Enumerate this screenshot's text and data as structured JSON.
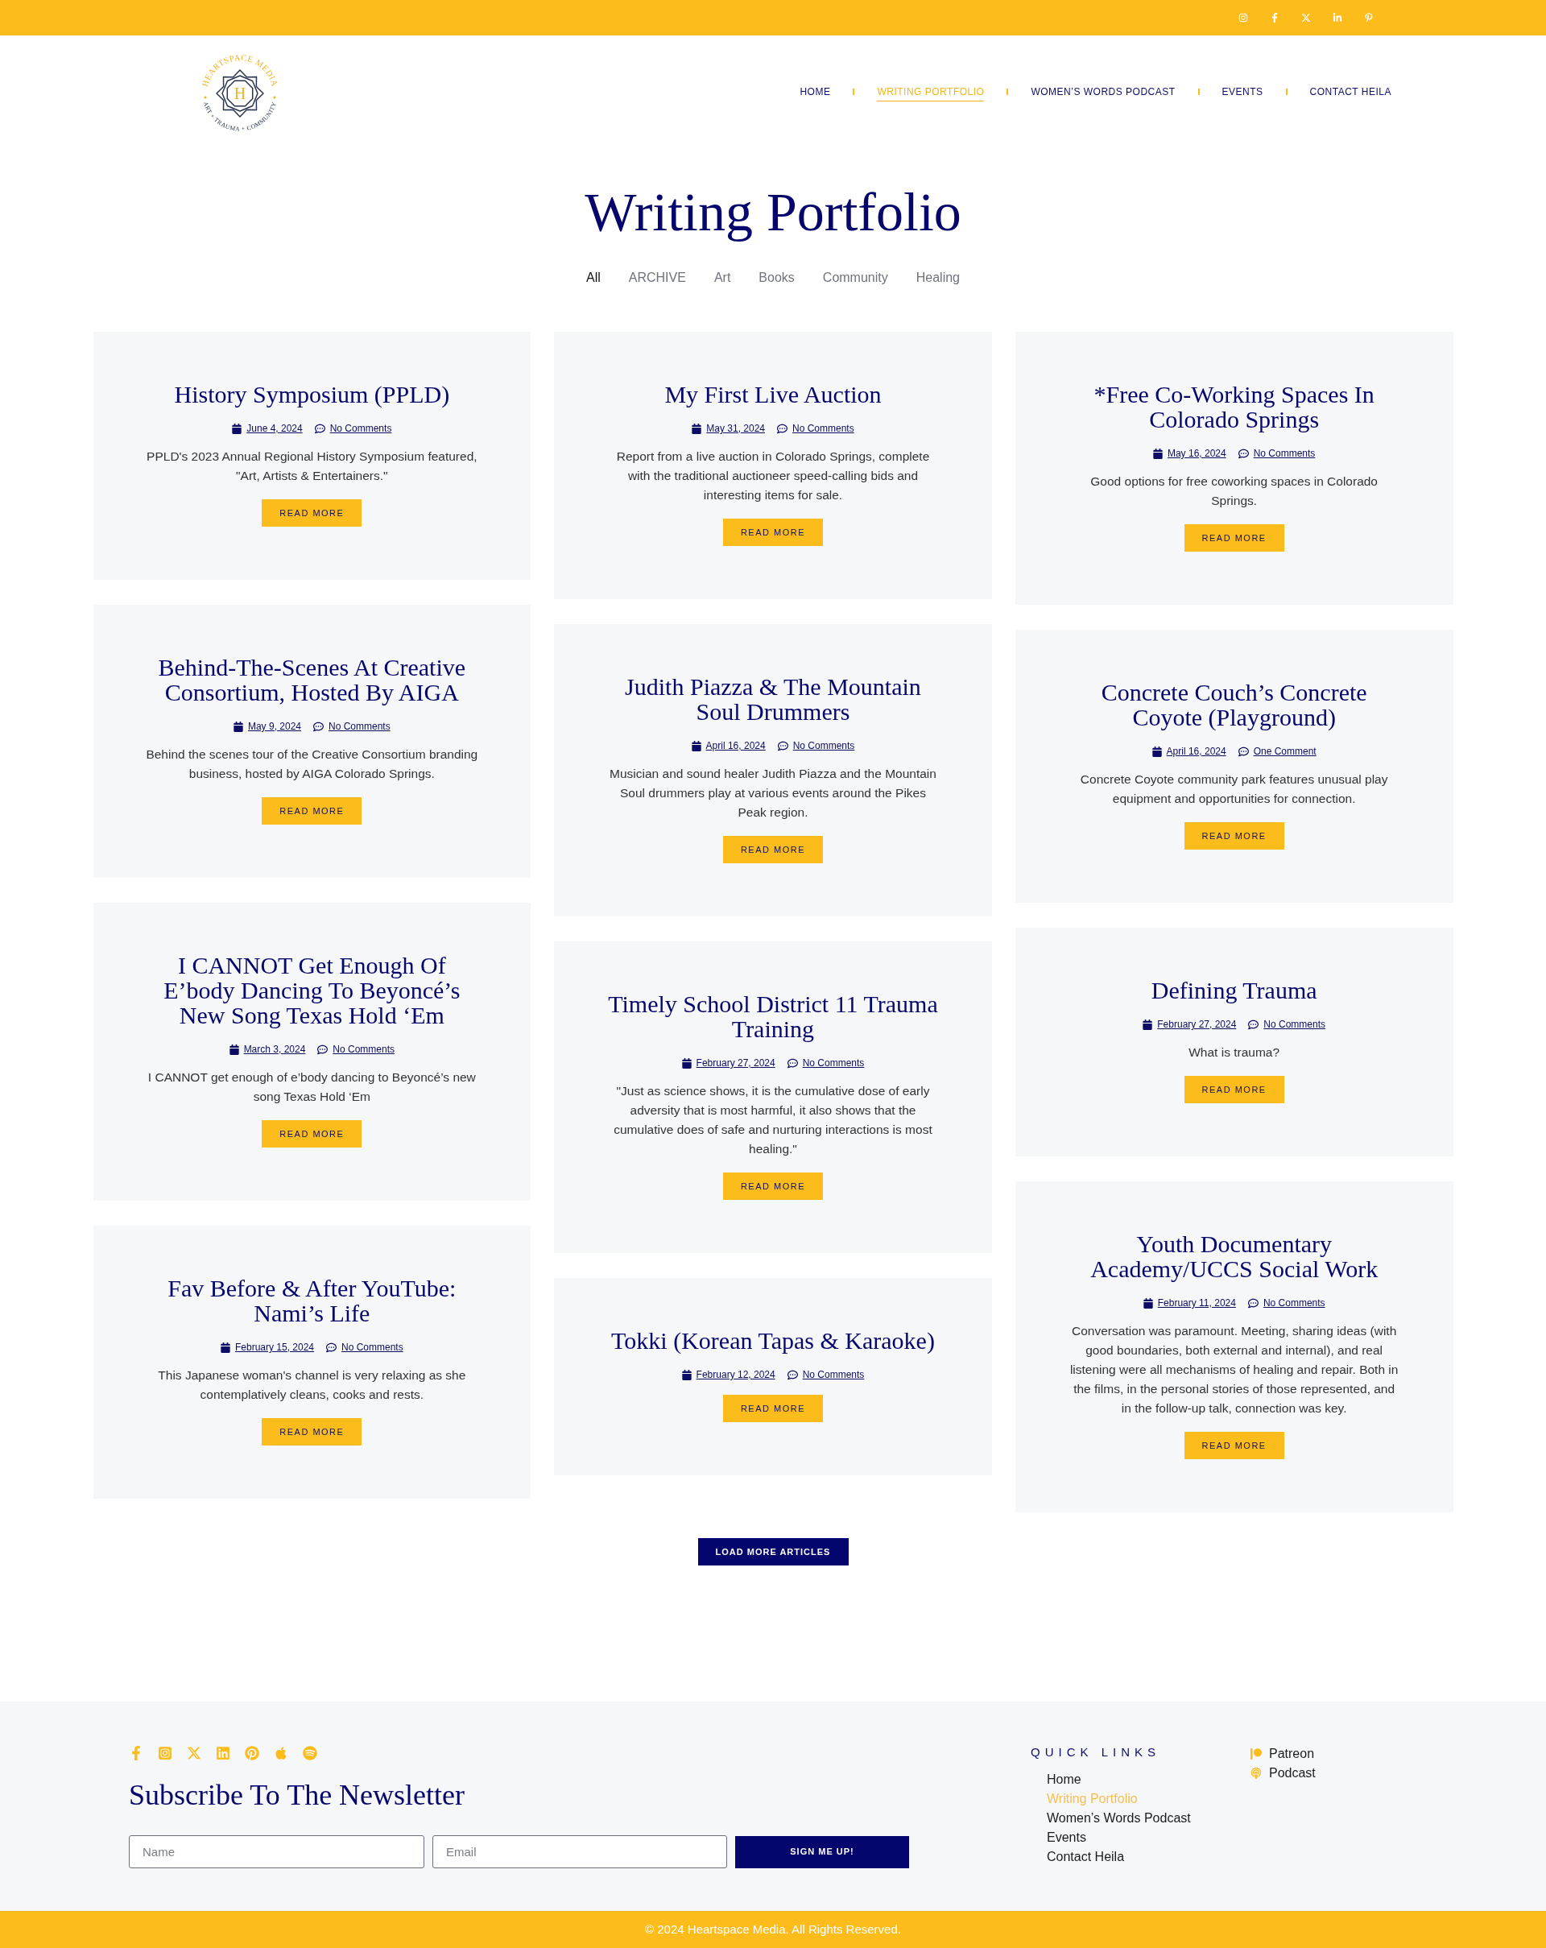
{
  "top_bar": {
    "social_links": [
      {
        "kind": "instagram"
      },
      {
        "kind": "facebook"
      },
      {
        "kind": "x"
      },
      {
        "kind": "linkedin"
      },
      {
        "kind": "pinterest"
      }
    ]
  },
  "header": {
    "logo": {
      "arc_text": "HEARTSPACE MEDIA",
      "tagline": "ART + TRAUMA + COMMUNITY",
      "monogram": "H"
    },
    "nav": [
      {
        "label": "HOME",
        "selected": false
      },
      {
        "label": "WRITING PORTFOLIO",
        "selected": true
      },
      {
        "label": "WOMEN’S WORDS PODCAST",
        "selected": false
      },
      {
        "label": "EVENTS",
        "selected": false
      },
      {
        "label": "CONTACT HEILA",
        "selected": false
      }
    ]
  },
  "page_title": "Writing Portfolio",
  "filters": [
    {
      "label": "All",
      "selected": true
    },
    {
      "label": "ARCHIVE",
      "selected": false
    },
    {
      "label": "Art",
      "selected": false
    },
    {
      "label": "Books",
      "selected": false
    },
    {
      "label": "Community",
      "selected": false
    },
    {
      "label": "Healing",
      "selected": false
    }
  ],
  "post_columns": [
    {
      "posts": [
        {
          "title": "History Symposium (PPLD)",
          "date": "June 4, 2024",
          "comments": "No Comments",
          "excerpt": "PPLD's 2023 Annual Regional History Symposium featured, \"Art, Artists & Entertainers.\"",
          "button": "READ MORE"
        },
        {
          "title": "Behind-The-Scenes At Creative Consortium, Hosted By AIGA",
          "date": "May 9, 2024",
          "comments": "No Comments",
          "excerpt": "Behind the scenes tour of the Creative Consortium branding business, hosted by AIGA Colorado Springs.",
          "button": "READ MORE"
        },
        {
          "title": "I CANNOT Get Enough Of E’body Dancing To Beyoncé’s New Song Texas Hold ‘Em",
          "date": "March 3, 2024",
          "comments": "No Comments",
          "excerpt": "I CANNOT get enough of e’body dancing to Beyoncé’s new song Texas Hold ‘Em",
          "button": "READ MORE"
        },
        {
          "title": "Fav Before & After YouTube: Nami’s Life",
          "date": "February 15, 2024",
          "comments": "No Comments",
          "excerpt": "This Japanese woman's channel is very relaxing as she contemplatively cleans, cooks and rests.",
          "button": "READ MORE"
        }
      ]
    },
    {
      "posts": [
        {
          "title": "My First Live Auction",
          "date": "May 31, 2024",
          "comments": "No Comments",
          "excerpt": "Report from a live auction in Colorado Springs, complete with the traditional auctioneer speed-calling bids and interesting items for sale.",
          "button": "READ MORE"
        },
        {
          "title": "Judith Piazza & The Mountain Soul Drummers",
          "date": "April 16, 2024",
          "comments": "No Comments",
          "excerpt": "Musician and sound healer Judith Piazza and the Mountain Soul drummers play at various events around the Pikes Peak region.",
          "button": "READ MORE"
        },
        {
          "title": "Timely School District 11 Trauma Training",
          "date": "February 27, 2024",
          "comments": "No Comments",
          "excerpt": "\"Just as science shows, it is the cumulative dose of early adversity that is most harmful, it also shows that the cumulative does of safe and nurturing interactions is most healing.\"",
          "button": "READ MORE"
        },
        {
          "title": "Tokki (Korean Tapas & Karaoke)",
          "date": "February 12, 2024",
          "comments": "No Comments",
          "button": "READ MORE"
        }
      ]
    },
    {
      "posts": [
        {
          "title": "*Free Co-Working Spaces In Colorado Springs",
          "date": "May 16, 2024",
          "comments": "No Comments",
          "excerpt": "Good options for free coworking spaces in Colorado Springs.",
          "button": "READ MORE"
        },
        {
          "title": "Concrete Couch’s Concrete Coyote (Playground)",
          "date": "April 16, 2024",
          "comments": "One Comment",
          "excerpt": "Concrete Coyote community park features unusual play equipment and opportunities for connection.",
          "button": "READ MORE"
        },
        {
          "title": "Defining Trauma",
          "date": "February 27, 2024",
          "comments": "No Comments",
          "excerpt": "What is trauma?",
          "button": "READ MORE"
        },
        {
          "title": "Youth Documentary Academy/UCCS Social Work",
          "date": "February 11, 2024",
          "comments": "No Comments",
          "excerpt": "Conversation was paramount. Meeting, sharing ideas (with good boundaries, both external and internal), and real listening were all mechanisms of healing and repair. Both in the films, in the personal stories of those represented, and in the follow-up talk, connection was key.",
          "button": "READ MORE"
        }
      ]
    }
  ],
  "load_more": "LOAD MORE ARTICLES",
  "footer": {
    "social_links": [
      {
        "kind": "facebook"
      },
      {
        "kind": "instagram"
      },
      {
        "kind": "x"
      },
      {
        "kind": "linkedin"
      },
      {
        "kind": "pinterest"
      },
      {
        "kind": "apple"
      },
      {
        "kind": "spotify"
      }
    ],
    "newsletter": {
      "heading": "Subscribe To The Newsletter",
      "name_field": {
        "placeholder": "Name"
      },
      "email_field": {
        "placeholder": "Email"
      },
      "button": "SIGN ME UP!"
    },
    "quick_links": {
      "heading": "QUICK LINKS",
      "items": [
        {
          "label": "Home",
          "selected": false
        },
        {
          "label": "Writing Portfolio",
          "selected": true
        },
        {
          "label": "Women’s Words Podcast",
          "selected": false
        },
        {
          "label": "Events",
          "selected": false
        },
        {
          "label": "Contact Heila",
          "selected": false
        }
      ]
    },
    "extra_links": [
      {
        "kind": "patreon",
        "label": "Patreon"
      },
      {
        "kind": "podcast",
        "label": "Podcast"
      }
    ]
  },
  "copyright": "© 2024 Heartspace Media. All Rights Reserved."
}
